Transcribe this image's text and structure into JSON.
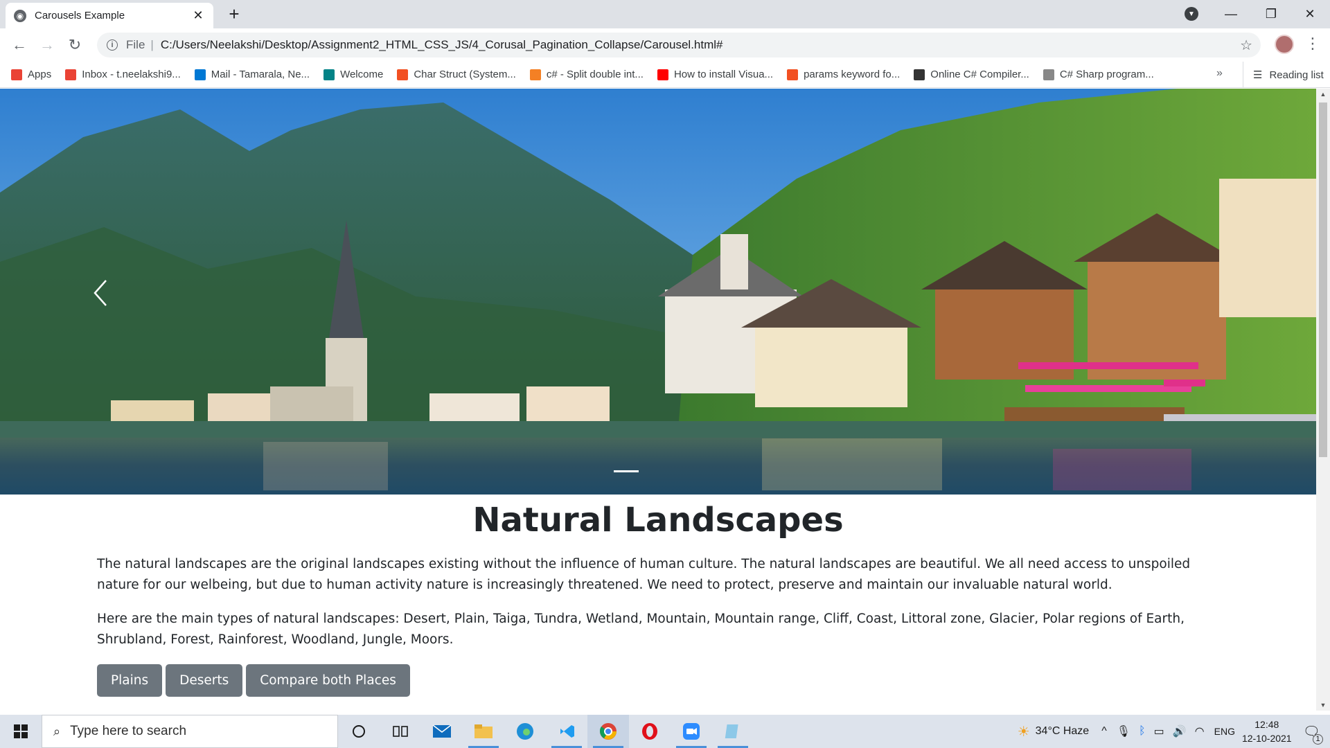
{
  "browser": {
    "tab_title": "Carousels Example",
    "tab_close": "✕",
    "new_tab": "+",
    "url_scheme": "File",
    "url": "C:/Users/Neelakshi/Desktop/Assignment2_HTML_CSS_JS/4_Corusal_Pagination_Collapse/Carousel.html#",
    "bookmarks": [
      {
        "label": "Apps",
        "icon": "apps-grid-icon",
        "color": "#ea4335"
      },
      {
        "label": "Inbox - t.neelakshi9...",
        "icon": "gmail-icon",
        "color": "#ea4335"
      },
      {
        "label": "Mail - Tamarala, Ne...",
        "icon": "outlook-icon",
        "color": "#0078d4"
      },
      {
        "label": "Welcome",
        "icon": "sharepoint-icon",
        "color": "#038387"
      },
      {
        "label": "Char Struct (System...",
        "icon": "microsoft-icon",
        "color": "#f25022"
      },
      {
        "label": "c# - Split double int...",
        "icon": "stackoverflow-icon",
        "color": "#f48024"
      },
      {
        "label": "How to install Visua...",
        "icon": "youtube-icon",
        "color": "#ff0000"
      },
      {
        "label": "params keyword fo...",
        "icon": "microsoft-icon",
        "color": "#f25022"
      },
      {
        "label": "Online C# Compiler...",
        "icon": "compiler-icon",
        "color": "#333333"
      },
      {
        "label": "C# Sharp program...",
        "icon": "w3r-icon",
        "color": "#888888"
      }
    ],
    "more_bookmarks": "»",
    "reading_list": "Reading list"
  },
  "page": {
    "title": "Natural Landscapes",
    "paragraph1": "The natural landscapes are the original landscapes existing without the influence of human culture. The natural landscapes are beautiful. We all need access to unspoiled nature for our welbeing, but due to human activity nature is increasingly threatened. We need to protect, preserve and maintain our invaluable natural world.",
    "paragraph2": "Here are the main types of natural landscapes: Desert, Plain, Taiga, Tundra, Wetland, Mountain, Mountain range, Cliff, Coast, Littoral zone, Glacier, Polar regions of Earth, Shrubland, Forest, Rainforest, Woodland, Jungle, Moors.",
    "buttons": [
      "Plains",
      "Deserts",
      "Compare both Places"
    ]
  },
  "taskbar": {
    "search_placeholder": "Type here to search",
    "weather": "34°C  Haze",
    "language": "ENG",
    "time": "12:48",
    "date": "12-10-2021",
    "notification_count": "1"
  }
}
